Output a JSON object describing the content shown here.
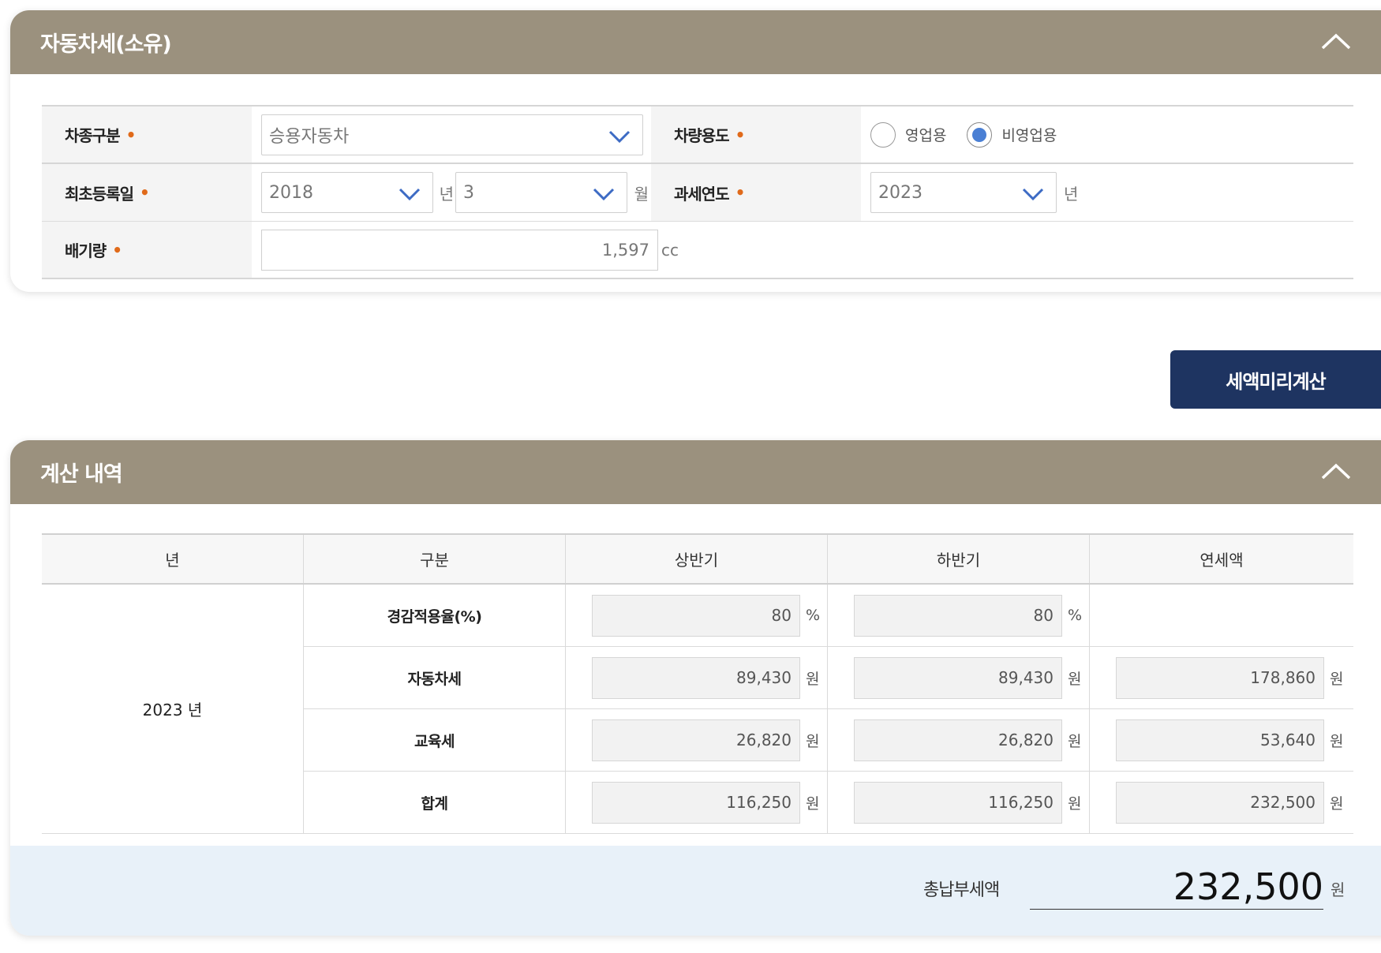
{
  "section1": {
    "title": "자동차세(소유)",
    "car_type_label": "차종구분",
    "car_type_value": "승용자동차",
    "usage_label": "차량용도",
    "usage_options": [
      "영업용",
      "비영업용"
    ],
    "usage_selected": "비영업용",
    "reg_date_label": "최초등록일",
    "reg_year": "2018",
    "year_unit": "년",
    "reg_month": "3",
    "month_unit": "월",
    "tax_year_label": "과세연도",
    "tax_year": "2023",
    "tax_year_unit": "년",
    "displacement_label": "배기량",
    "displacement_value": "1,597",
    "displacement_unit": "cc",
    "required_mark": "•"
  },
  "calc_button": "세액미리계산",
  "section2": {
    "title": "계산 내역",
    "headers": [
      "년",
      "구분",
      "상반기",
      "하반기",
      "연세액"
    ],
    "year": "2023 년",
    "rows": [
      {
        "label": "경감적용율(%)",
        "first": "80",
        "first_unit": "%",
        "second": "80",
        "second_unit": "%",
        "annual": "",
        "annual_unit": ""
      },
      {
        "label": "자동차세",
        "first": "89,430",
        "first_unit": "원",
        "second": "89,430",
        "second_unit": "원",
        "annual": "178,860",
        "annual_unit": "원"
      },
      {
        "label": "교육세",
        "first": "26,820",
        "first_unit": "원",
        "second": "26,820",
        "second_unit": "원",
        "annual": "53,640",
        "annual_unit": "원"
      },
      {
        "label": "합계",
        "first": "116,250",
        "first_unit": "원",
        "second": "116,250",
        "second_unit": "원",
        "annual": "232,500",
        "annual_unit": "원"
      }
    ],
    "total_label": "총납부세액",
    "total_value": "232,500",
    "total_unit": "원"
  },
  "colors": {
    "header": "#9b917e",
    "button": "#1e3461",
    "radio_on": "#4a7fd4",
    "required_dot": "#e06a1a",
    "total_bg": "#e8f1f9"
  },
  "icons": {
    "collapse": "chevron-up-icon",
    "dropdown": "chevron-down-icon"
  }
}
